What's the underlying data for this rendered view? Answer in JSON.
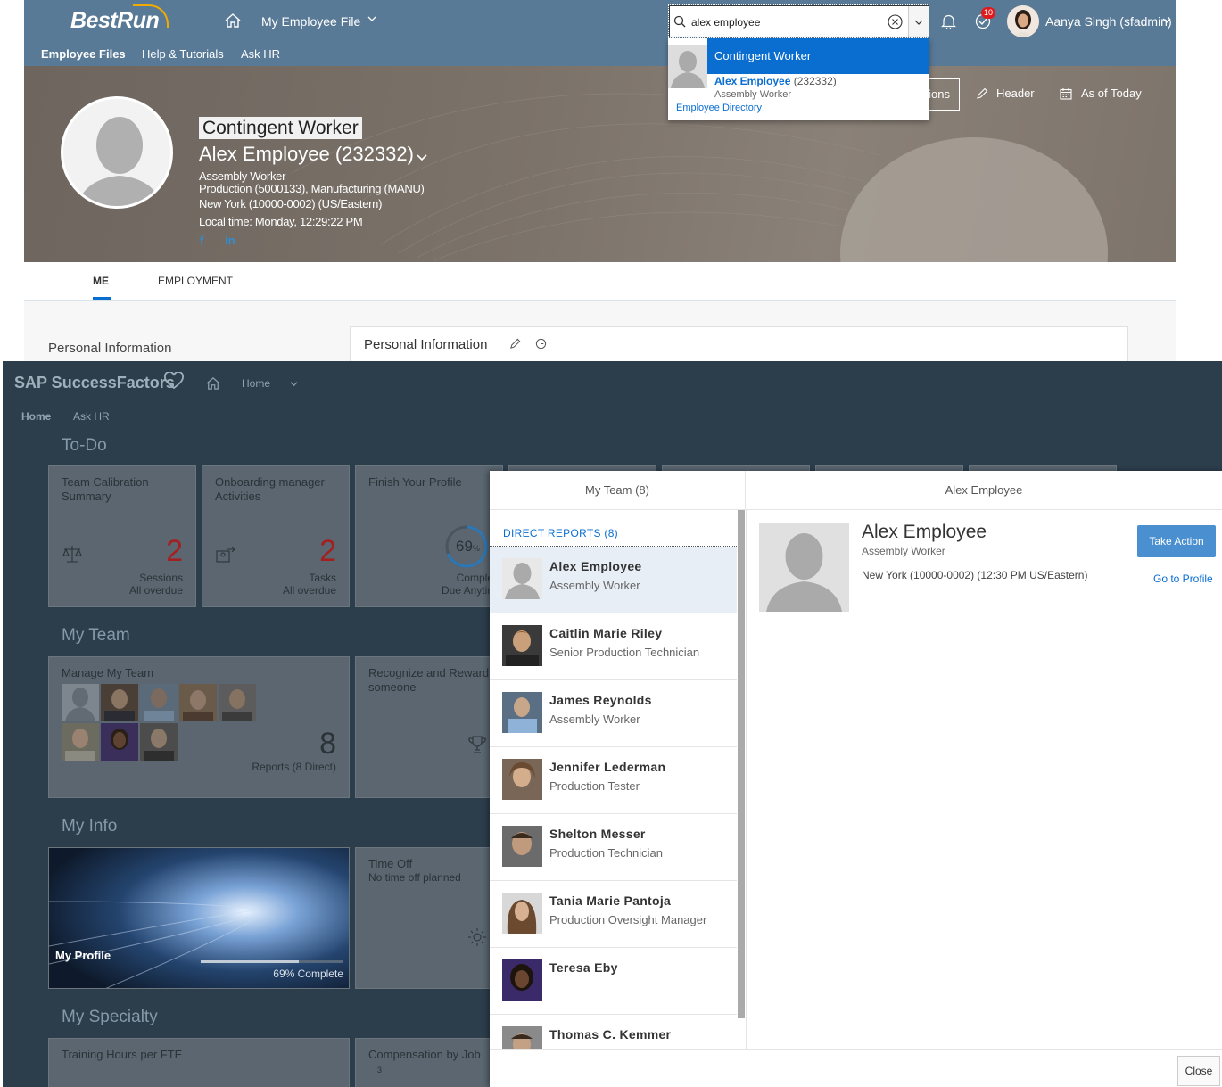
{
  "top": {
    "logo": "BestRun",
    "nav_label": "My Employee File",
    "subnav": [
      "Employee Files",
      "Help & Tutorials",
      "Ask HR"
    ],
    "search": {
      "value": "alex employee"
    },
    "notification_badge": "10",
    "user_name": "Aanya Singh (sfadmin)",
    "dropdown": {
      "selected": "Contingent Worker",
      "result_name": "Alex Employee",
      "result_id": "(232332)",
      "result_title": "Assembly Worker",
      "directory_link": "Employee Directory"
    },
    "profile": {
      "badge": "Contingent Worker",
      "name": "Alex Employee (232332)",
      "title": "Assembly Worker",
      "department": "Production (5000133), Manufacturing (MANU)",
      "location": "New York (10000-0002) (US/Eastern)",
      "local_time": "Local time: Monday, 12:29:22 PM",
      "facebook": "f",
      "linkedin": "in"
    },
    "header_actions": {
      "actions_partial": "ions",
      "header": "Header",
      "as_of": "As of Today"
    },
    "tabs": [
      "ME",
      "EMPLOYMENT"
    ],
    "section_label": "Personal Information",
    "card_title": "Personal Information"
  },
  "bottom": {
    "logo": "SAP SuccessFactors",
    "nav_label": "Home",
    "subnav": [
      "Home",
      "Ask HR"
    ],
    "sections": {
      "todo": "To-Do",
      "team": "My Team",
      "info": "My Info",
      "specialty": "My Specialty"
    },
    "todo_tiles": [
      {
        "title": "Team Calibration Summary",
        "count": "2",
        "unit": "Sessions",
        "status": "All overdue"
      },
      {
        "title": "Onboarding manager Activities",
        "count": "2",
        "unit": "Tasks",
        "status": "All overdue"
      },
      {
        "title": "Finish Your Profile",
        "percent": "69",
        "percent_sign": "%",
        "unit": "Complete",
        "status": "Due Anytime"
      }
    ],
    "team_tiles": {
      "manage_title": "Manage My Team",
      "count": "8",
      "count_label": "Reports (8 Direct)",
      "recognize_title": "Recognize and Reward someone"
    },
    "info_tiles": {
      "profile_label": "My Profile",
      "profile_progress": 0.69,
      "profile_complete": "69% Complete",
      "timeoff_title": "Time Off",
      "timeoff_sub": "No time off planned"
    },
    "specialty_tiles": {
      "training": "Training Hours per FTE",
      "compensation": "Compensation by Job",
      "comp_axis": "3"
    },
    "popup": {
      "left_header": "My Team (8)",
      "right_header": "Alex Employee",
      "direct_reports": "DIRECT REPORTS (8)",
      "members": [
        {
          "name": "Alex Employee",
          "title": "Assembly Worker"
        },
        {
          "name": "Caitlin Marie Riley",
          "title": "Senior Production Technician"
        },
        {
          "name": "James Reynolds",
          "title": "Assembly Worker"
        },
        {
          "name": "Jennifer Lederman",
          "title": "Production Tester"
        },
        {
          "name": "Shelton Messer",
          "title": "Production Technician"
        },
        {
          "name": "Tania Marie Pantoja",
          "title": "Production Oversight Manager"
        },
        {
          "name": "Teresa Eby",
          "title": ""
        },
        {
          "name": "Thomas C. Kemmer",
          "title": ""
        }
      ],
      "detail": {
        "name": "Alex Employee",
        "title": "Assembly Worker",
        "location": "New York (10000-0002) (12:30 PM US/Eastern)",
        "take_action": "Take Action",
        "go_to_profile": "Go to Profile"
      },
      "close": "Close"
    }
  }
}
